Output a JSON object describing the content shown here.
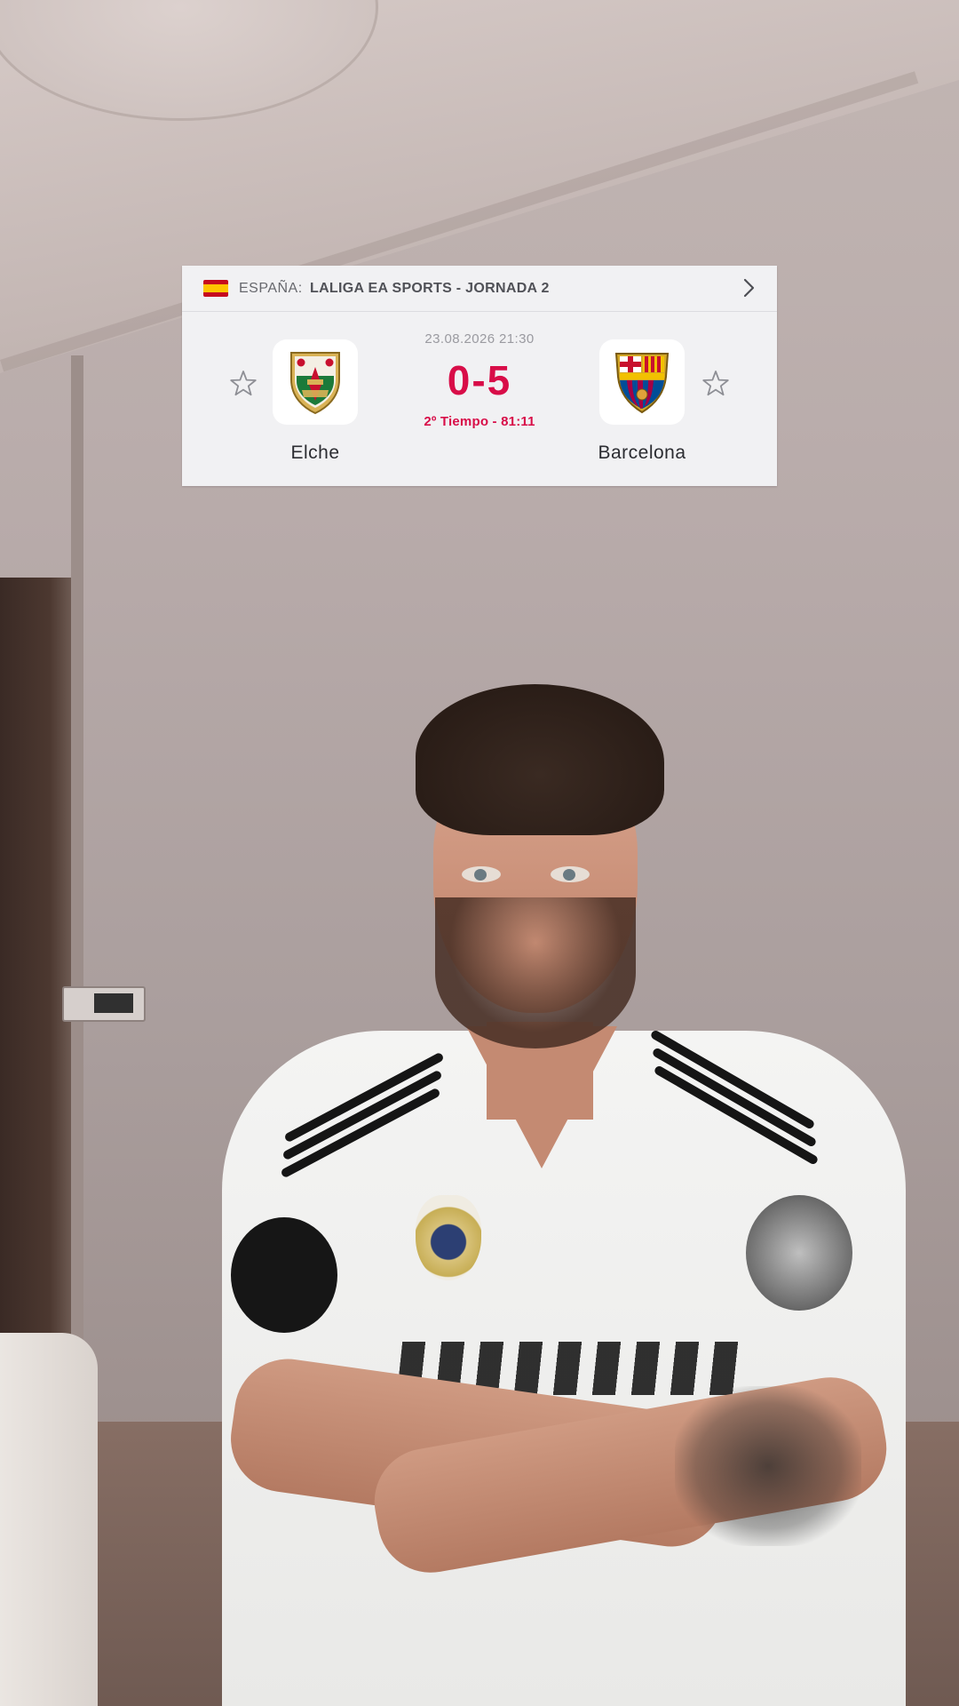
{
  "match": {
    "country": "ESPAÑA:",
    "league": "LALIGA EA SPORTS - JORNADA 2",
    "datetime": "23.08.2026 21:30",
    "score": "0-5",
    "status": "2º Tiempo - 81:11",
    "home_team": "Elche",
    "away_team": "Barcelona"
  },
  "icons": {
    "flag": "spain-flag-icon",
    "chevron": "chevron-right-icon",
    "favorite": "star-outline-icon",
    "home_logo": "elche-crest-icon",
    "away_logo": "fc-barcelona-crest-icon"
  },
  "colors": {
    "widget_background": "#f1f1f3",
    "live_accent": "#d80d48",
    "team_text": "#2b2c31",
    "meta_text": "#9a9aa0"
  }
}
